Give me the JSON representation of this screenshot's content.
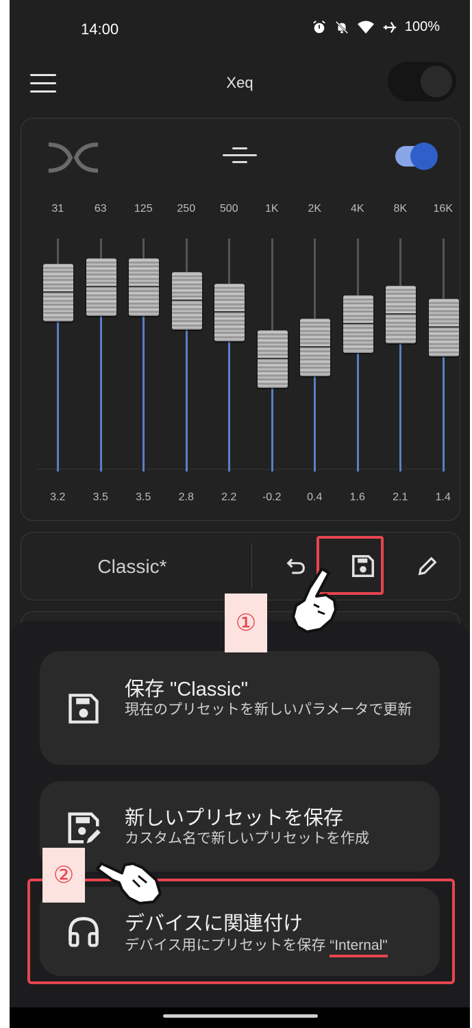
{
  "status_bar": {
    "time": "14:00",
    "battery": "100%",
    "icons": [
      "alarm-icon",
      "mute-icon",
      "wifi-icon",
      "airplane-icon"
    ]
  },
  "app_bar": {
    "title": "Xeq",
    "menu_icon": "hamburger-menu-icon",
    "power_toggle_on": false
  },
  "equalizer": {
    "logo_icon": "xeq-logo-icon",
    "mode_icon": "equalizer-mode-icon",
    "enabled": true,
    "bands": [
      {
        "freq": "31",
        "gain": "3.2"
      },
      {
        "freq": "63",
        "gain": "3.5"
      },
      {
        "freq": "125",
        "gain": "3.5"
      },
      {
        "freq": "250",
        "gain": "2.8"
      },
      {
        "freq": "500",
        "gain": "2.2"
      },
      {
        "freq": "1K",
        "gain": "-0.2"
      },
      {
        "freq": "2K",
        "gain": "0.4"
      },
      {
        "freq": "4K",
        "gain": "1.6"
      },
      {
        "freq": "8K",
        "gain": "2.1"
      },
      {
        "freq": "16K",
        "gain": "1.4"
      }
    ]
  },
  "preset_bar": {
    "preset_name": "Classic*",
    "undo_icon": "undo-icon",
    "save_icon": "save-icon",
    "edit_icon": "edit-pencil-icon"
  },
  "annotations": {
    "step1": "①",
    "step2": "②",
    "accent_color": "#e8454f"
  },
  "sheet": {
    "options": [
      {
        "title": "保存 \"Classic\"",
        "desc": "現在のプリセットを新しいパラメータで更新",
        "icon": "save-icon"
      },
      {
        "title": "新しいプリセットを保存",
        "desc": "カスタム名で新しいプリセットを作成",
        "icon": "save-new-icon"
      },
      {
        "title": "デバイスに関連付け",
        "desc_prefix": "デバイス用にプリセットを保存 ",
        "desc_device": "“Internal\"",
        "icon": "headphones-icon"
      }
    ]
  },
  "colors": {
    "background": "#202020",
    "slider_fill": "#5a7ec8",
    "toggle_knob": "#2f5fc9"
  }
}
